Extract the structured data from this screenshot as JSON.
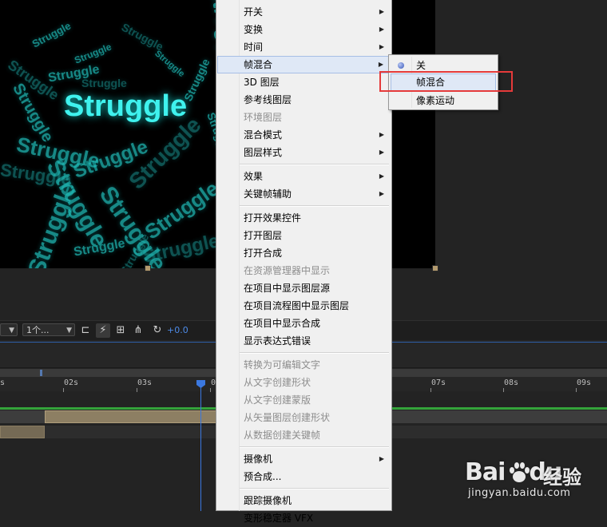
{
  "composition": {
    "featured_word": "Struggle",
    "background_word": "Struggle"
  },
  "toolbar": {
    "zoom_value": "",
    "view_value": "1个...",
    "exposure_offset": "+0.0"
  },
  "timeline": {
    "ruler_ticks": [
      "s",
      "02s",
      "03s",
      "0",
      "07s",
      "08s",
      "09s"
    ]
  },
  "context_menu": {
    "items": [
      {
        "label": "开关",
        "submenu": true
      },
      {
        "label": "变换",
        "submenu": true
      },
      {
        "label": "时间",
        "submenu": true
      },
      {
        "label": "帧混合",
        "submenu": true,
        "active": true
      },
      {
        "label": "3D 图层"
      },
      {
        "label": "参考线图层"
      },
      {
        "label": "环境图层",
        "disabled": true
      },
      {
        "label": "混合模式",
        "submenu": true
      },
      {
        "label": "图层样式",
        "submenu": true
      },
      {
        "label": "效果",
        "submenu": true
      },
      {
        "label": "关键帧辅助",
        "submenu": true
      },
      {
        "label": "打开效果控件"
      },
      {
        "label": "打开图层"
      },
      {
        "label": "打开合成"
      },
      {
        "label": "在资源管理器中显示",
        "disabled": true
      },
      {
        "label": "在项目中显示图层源"
      },
      {
        "label": "在项目流程图中显示图层"
      },
      {
        "label": "在项目中显示合成"
      },
      {
        "label": "显示表达式错误"
      },
      {
        "label": "转换为可编辑文字",
        "disabled": true
      },
      {
        "label": "从文字创建形状",
        "disabled": true
      },
      {
        "label": "从文字创建蒙版",
        "disabled": true
      },
      {
        "label": "从矢量图层创建形状",
        "disabled": true
      },
      {
        "label": "从数据创建关键帧",
        "disabled": true
      },
      {
        "label": "摄像机",
        "submenu": true
      },
      {
        "label": "预合成..."
      },
      {
        "label": "跟踪摄像机"
      },
      {
        "label": "变形稳定器 VFX"
      }
    ]
  },
  "submenu": {
    "items": [
      {
        "label": "关",
        "selected": true
      },
      {
        "label": "帧混合",
        "hover": true
      },
      {
        "label": "像素运动"
      }
    ]
  },
  "watermark": {
    "logo_text": "Bai",
    "logo_text_2": "du",
    "cn_text": "经验",
    "url": "jingyan.baidu.com"
  },
  "colors": {
    "accent_blue": "#3b78e0",
    "highlight_red": "#e53a3a",
    "text_cyan": "#3ff2ee"
  }
}
